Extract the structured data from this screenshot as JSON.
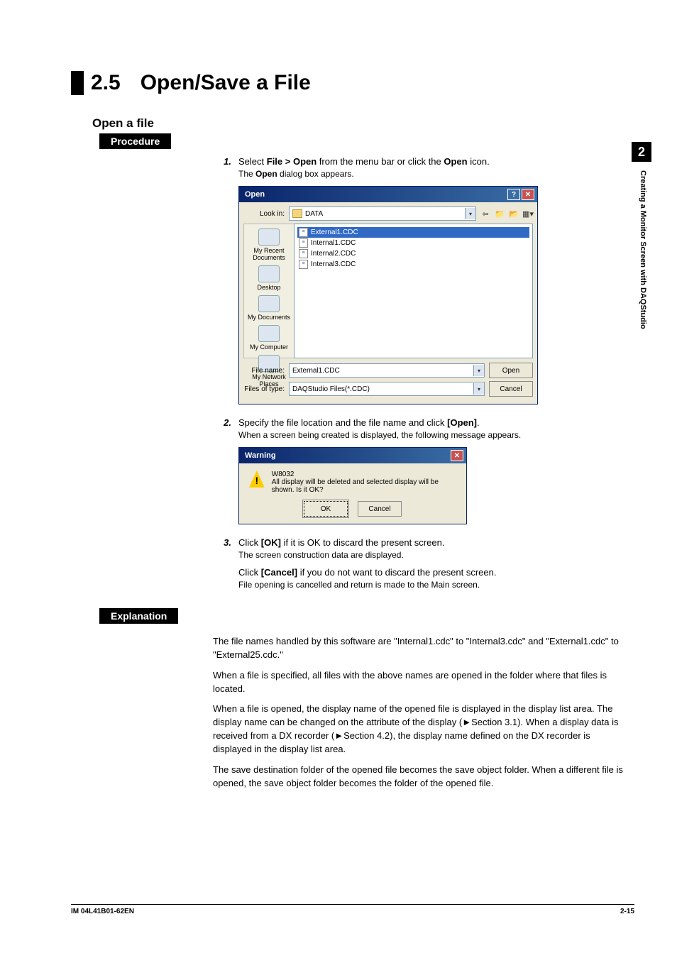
{
  "section": {
    "number": "2.5",
    "title": "Open/Save a File"
  },
  "side_tab": {
    "chapter_num": "2",
    "chapter_title": "Creating a Monitor Screen with DAQStudio"
  },
  "subheads": {
    "open_file": "Open a file",
    "procedure": "Procedure",
    "explanation": "Explanation"
  },
  "steps": {
    "s1": {
      "num": "1.",
      "text_pre": "Select ",
      "menu": "File > Open",
      "text_mid": " from the menu bar or click the ",
      "icon": "Open",
      "text_post": " icon.",
      "detail_a": "The ",
      "detail_b": "Open",
      "detail_c": " dialog box appears."
    },
    "s2": {
      "num": "2.",
      "text_pre": "Specify the file location and the file name and click ",
      "btn": "[Open]",
      "text_post": ".",
      "detail": "When a screen being created is displayed, the following message appears."
    },
    "s3": {
      "num": "3.",
      "ok_pre": "Click ",
      "ok_b": "[OK]",
      "ok_post": " if it is OK to discard the present screen.",
      "ok_detail": "The screen construction data are displayed.",
      "cancel_pre": "Click ",
      "cancel_b": "[Cancel]",
      "cancel_post": " if you do not want to discard the present screen.",
      "cancel_detail": "File opening is cancelled and return is made to the Main screen."
    }
  },
  "open_dialog": {
    "title": "Open",
    "lookin_label": "Look in:",
    "lookin_value": "DATA",
    "places": [
      "My Recent Documents",
      "Desktop",
      "My Documents",
      "My Computer",
      "My Network Places"
    ],
    "files": [
      "External1.CDC",
      "Internal1.CDC",
      "Internal2.CDC",
      "Internal3.CDC"
    ],
    "filename_label": "File name:",
    "filename_value": "External1.CDC",
    "filetype_label": "Files of type:",
    "filetype_value": "DAQStudio Files(*.CDC)",
    "btn_open": "Open",
    "btn_cancel": "Cancel"
  },
  "warning_dialog": {
    "title": "Warning",
    "code": "W8032",
    "message": "All display will be deleted and selected display will be shown. Is it OK?",
    "btn_ok": "OK",
    "btn_cancel": "Cancel"
  },
  "explanation": {
    "p1": "The file names handled by this software are \"Internal1.cdc\" to \"Internal3.cdc\" and \"External1.cdc\" to \"External25.cdc.\"",
    "p2": "When a file is specified, all files with the above names are opened in the folder where that files is located.",
    "p3": "When a file is opened, the display name of the opened file is displayed in the display list area. The display name can be changed on the attribute of the display (►Section 3.1). When a display data is received from a DX recorder (►Section 4.2), the display name defined on the DX recorder is displayed in the display list area.",
    "p4": "The save destination folder of the opened file becomes the save object folder. When a different file is opened, the save object folder becomes the folder of the opened file."
  },
  "footer": {
    "left": "IM 04L41B01-62EN",
    "right": "2-15"
  }
}
